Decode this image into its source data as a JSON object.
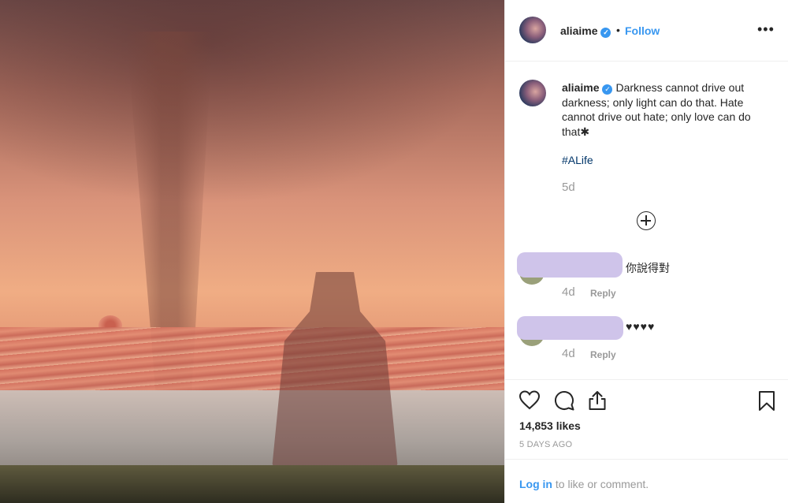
{
  "post": {
    "username": "aliaime",
    "verified_icon": "verified-badge-icon",
    "dot": "•",
    "follow_label": "Follow",
    "more_label": "•••"
  },
  "caption": {
    "username": "aliaime",
    "text": "Darkness cannot drive out darkness; only light can do that. Hate cannot drive out hate; only love can do that✱",
    "hashtag": "#ALife",
    "age": "5d"
  },
  "comments": [
    {
      "text": "你說得對",
      "age": "4d",
      "reply": "Reply"
    },
    {
      "text": "♥♥♥♥",
      "age": "4d",
      "reply": "Reply"
    }
  ],
  "actions": {
    "like_icon": "heart-icon",
    "comment_icon": "comment-icon",
    "share_icon": "share-icon",
    "save_icon": "bookmark-icon",
    "likes": "14,853 likes",
    "time": "5 DAYS AGO"
  },
  "login": {
    "link": "Log in",
    "text": " to like or comment."
  },
  "colors": {
    "accent": "#3897f0",
    "hashtag": "#003569",
    "muted": "#999999",
    "redaction": "#cfc4ea"
  }
}
